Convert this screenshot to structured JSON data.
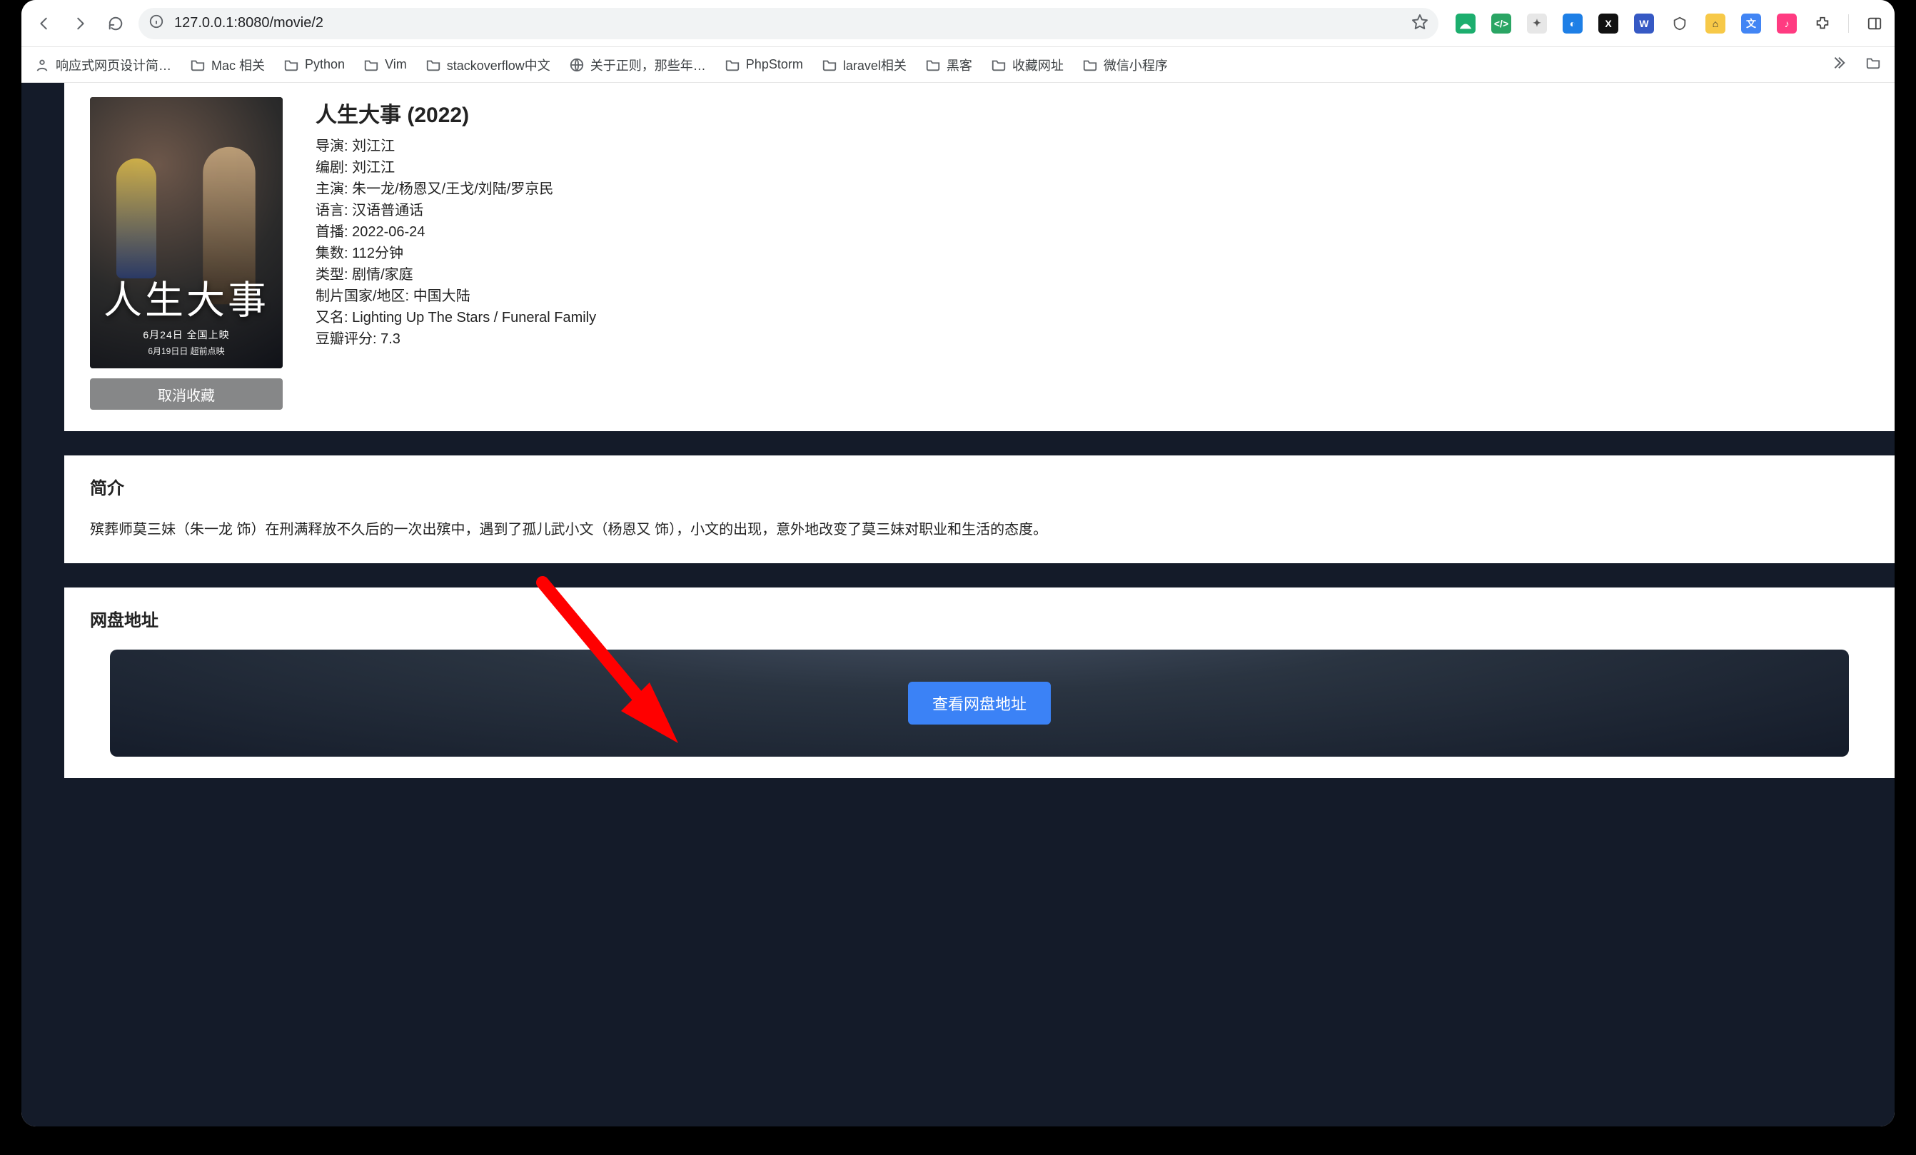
{
  "browser": {
    "url": "127.0.0.1:8080/movie/2"
  },
  "bookmarks": {
    "b0": "响应式网页设计简…",
    "b1": "Mac 相关",
    "b2": "Python",
    "b3": "Vim",
    "b4": "stackoverflow中文",
    "b5": "关于正则，那些年…",
    "b6": "PhpStorm",
    "b7": "laravel相关",
    "b8": "黑客",
    "b9": "收藏网址",
    "b10": "微信小程序"
  },
  "movie": {
    "title": "人生大事 (2022)",
    "poster": {
      "title_zh": "人生大事",
      "sub1": "6月24日 全国上映",
      "sub2": "6月19日日 超前点映"
    },
    "btn_unfavorite": "取消收藏",
    "labels": {
      "director": "导演:",
      "writer": "编剧:",
      "cast": "主演:",
      "language": "语言:",
      "premiere": "首播:",
      "episodes": "集数:",
      "genre": "类型:",
      "region": "制片国家/地区:",
      "aka": "又名:",
      "douban": "豆瓣评分:"
    },
    "values": {
      "director": "刘江江",
      "writer": "刘江江",
      "cast": "朱一龙/杨恩又/王戈/刘陆/罗京民",
      "language": "汉语普通话",
      "premiere": "2022-06-24",
      "episodes": "112分钟",
      "genre": "剧情/家庭",
      "region": "中国大陆",
      "aka": "Lighting Up The Stars / Funeral Family",
      "douban": "7.3"
    }
  },
  "synopsis": {
    "heading": "简介",
    "text": "殡葬师莫三妹（朱一龙 饰）在刑满释放不久后的一次出殡中，遇到了孤儿武小文（杨恩又 饰），小文的出现，意外地改变了莫三妹对职业和生活的态度。"
  },
  "netdisk": {
    "heading": "网盘地址",
    "button": "查看网盘地址"
  }
}
